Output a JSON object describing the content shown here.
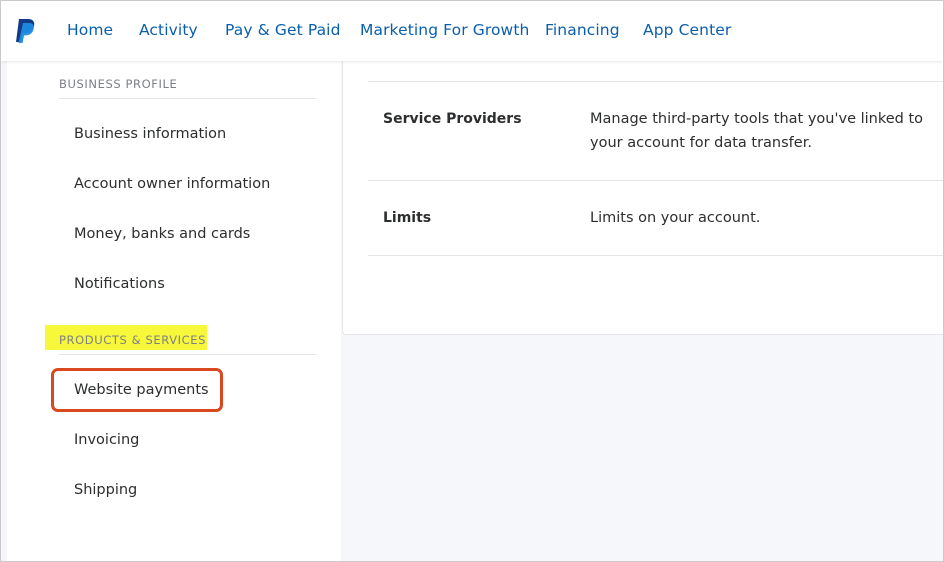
{
  "nav": {
    "logo": "paypal-logo",
    "items": [
      "Home",
      "Activity",
      "Pay & Get Paid",
      "Marketing For Growth",
      "Financing",
      "App Center"
    ],
    "color": "#0a5fad"
  },
  "sidebar": {
    "business_profile": {
      "label": "BUSINESS PROFILE",
      "items": [
        "Business information",
        "Account owner information",
        "Money, banks and cards",
        "Notifications"
      ]
    },
    "products_services": {
      "label": "PRODUCTS & SERVICES",
      "highlight_color": "#f8f83a",
      "items": [
        "Website payments",
        "Invoicing",
        "Shipping"
      ],
      "callout_item": "Website payments",
      "callout_color": "#d9481f"
    }
  },
  "content": {
    "rows": [
      {
        "title": "Service Providers",
        "description": "Manage third-party tools that you've linked to your account for data transfer."
      },
      {
        "title": "Limits",
        "description": "Limits on your account."
      }
    ]
  }
}
